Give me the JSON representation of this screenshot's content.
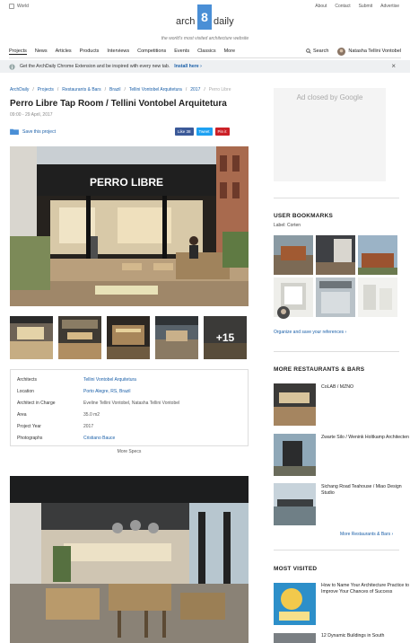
{
  "topbar": {
    "world": "World",
    "links": [
      "About",
      "Contact",
      "Submit",
      "Advertise"
    ]
  },
  "logo": {
    "part1": "arch",
    "box": "8",
    "part2": "daily",
    "tagline": "the world's most visited architecture website"
  },
  "nav": {
    "items": [
      "Projects",
      "News",
      "Articles",
      "Products",
      "Interviews",
      "Competitions",
      "Events",
      "Classics",
      "More"
    ],
    "search": "Search",
    "user": "Natasha Tellini Vontobel"
  },
  "banner": {
    "text": "Get the ArchDaily Chrome Extension and be inspired with every new tab.",
    "link": "Install here ›"
  },
  "breadcrumb": [
    "ArchDaily",
    "Projects",
    "Restaurants & Bars",
    "Brazil",
    "Tellini Vontobel Arquitetura",
    "2017",
    "Perro Libre"
  ],
  "project": {
    "title": "Perro Libre Tap Room / Tellini Vontobel Arquitetura",
    "date": "09:00 - 29 April, 2017",
    "save": "Save this project",
    "shares": {
      "like": "Like 38",
      "tweet": "Tweet",
      "pin": "Pin it"
    },
    "sign": "PERRO LIBRE",
    "more_photos": "+15",
    "specs": [
      {
        "k": "Architects",
        "v": "Tellini Vontobel Arquitetura",
        "link": true
      },
      {
        "k": "Location",
        "v": "Porto Alegre, RS, Brazil",
        "link": true
      },
      {
        "k": "Architect in Charge",
        "v": "Eveline Tellini Vontobel, Natasha Tellini Vontobel",
        "link": false
      },
      {
        "k": "Area",
        "v": "35.0 m2",
        "link": false
      },
      {
        "k": "Project Year",
        "v": "2017",
        "link": false
      },
      {
        "k": "Photographs",
        "v": "Cristiano Bauce",
        "link": true
      }
    ],
    "more_specs": "More Specs"
  },
  "sidebar": {
    "ad_text": "Ad closed by Google",
    "bookmarks_title": "USER BOOKMARKS",
    "bookmarks_label": "Label: Corten",
    "organize": "Organize and save your references ›",
    "more_title": "MORE RESTAURANTS & BARS",
    "more_items": [
      "CoLAB / MZNO",
      "Zwarte Silo / Wenink Holtkamp Architecten",
      "Sichang Road Teahouse / Miao Design Studio"
    ],
    "more_link": "More Restaurants & Bars ›",
    "mv_title": "MOST VISITED",
    "mv_items": [
      "How to Name Your Architecture Practice to Improve Your Chances of Success",
      "12 Dynamic Buildings in South"
    ]
  },
  "colors": {
    "accent": "#1a5fa8",
    "logo_blue": "#4a8fd6",
    "facebook": "#3b5998",
    "twitter": "#1da1f2",
    "pinterest": "#cb2027"
  }
}
